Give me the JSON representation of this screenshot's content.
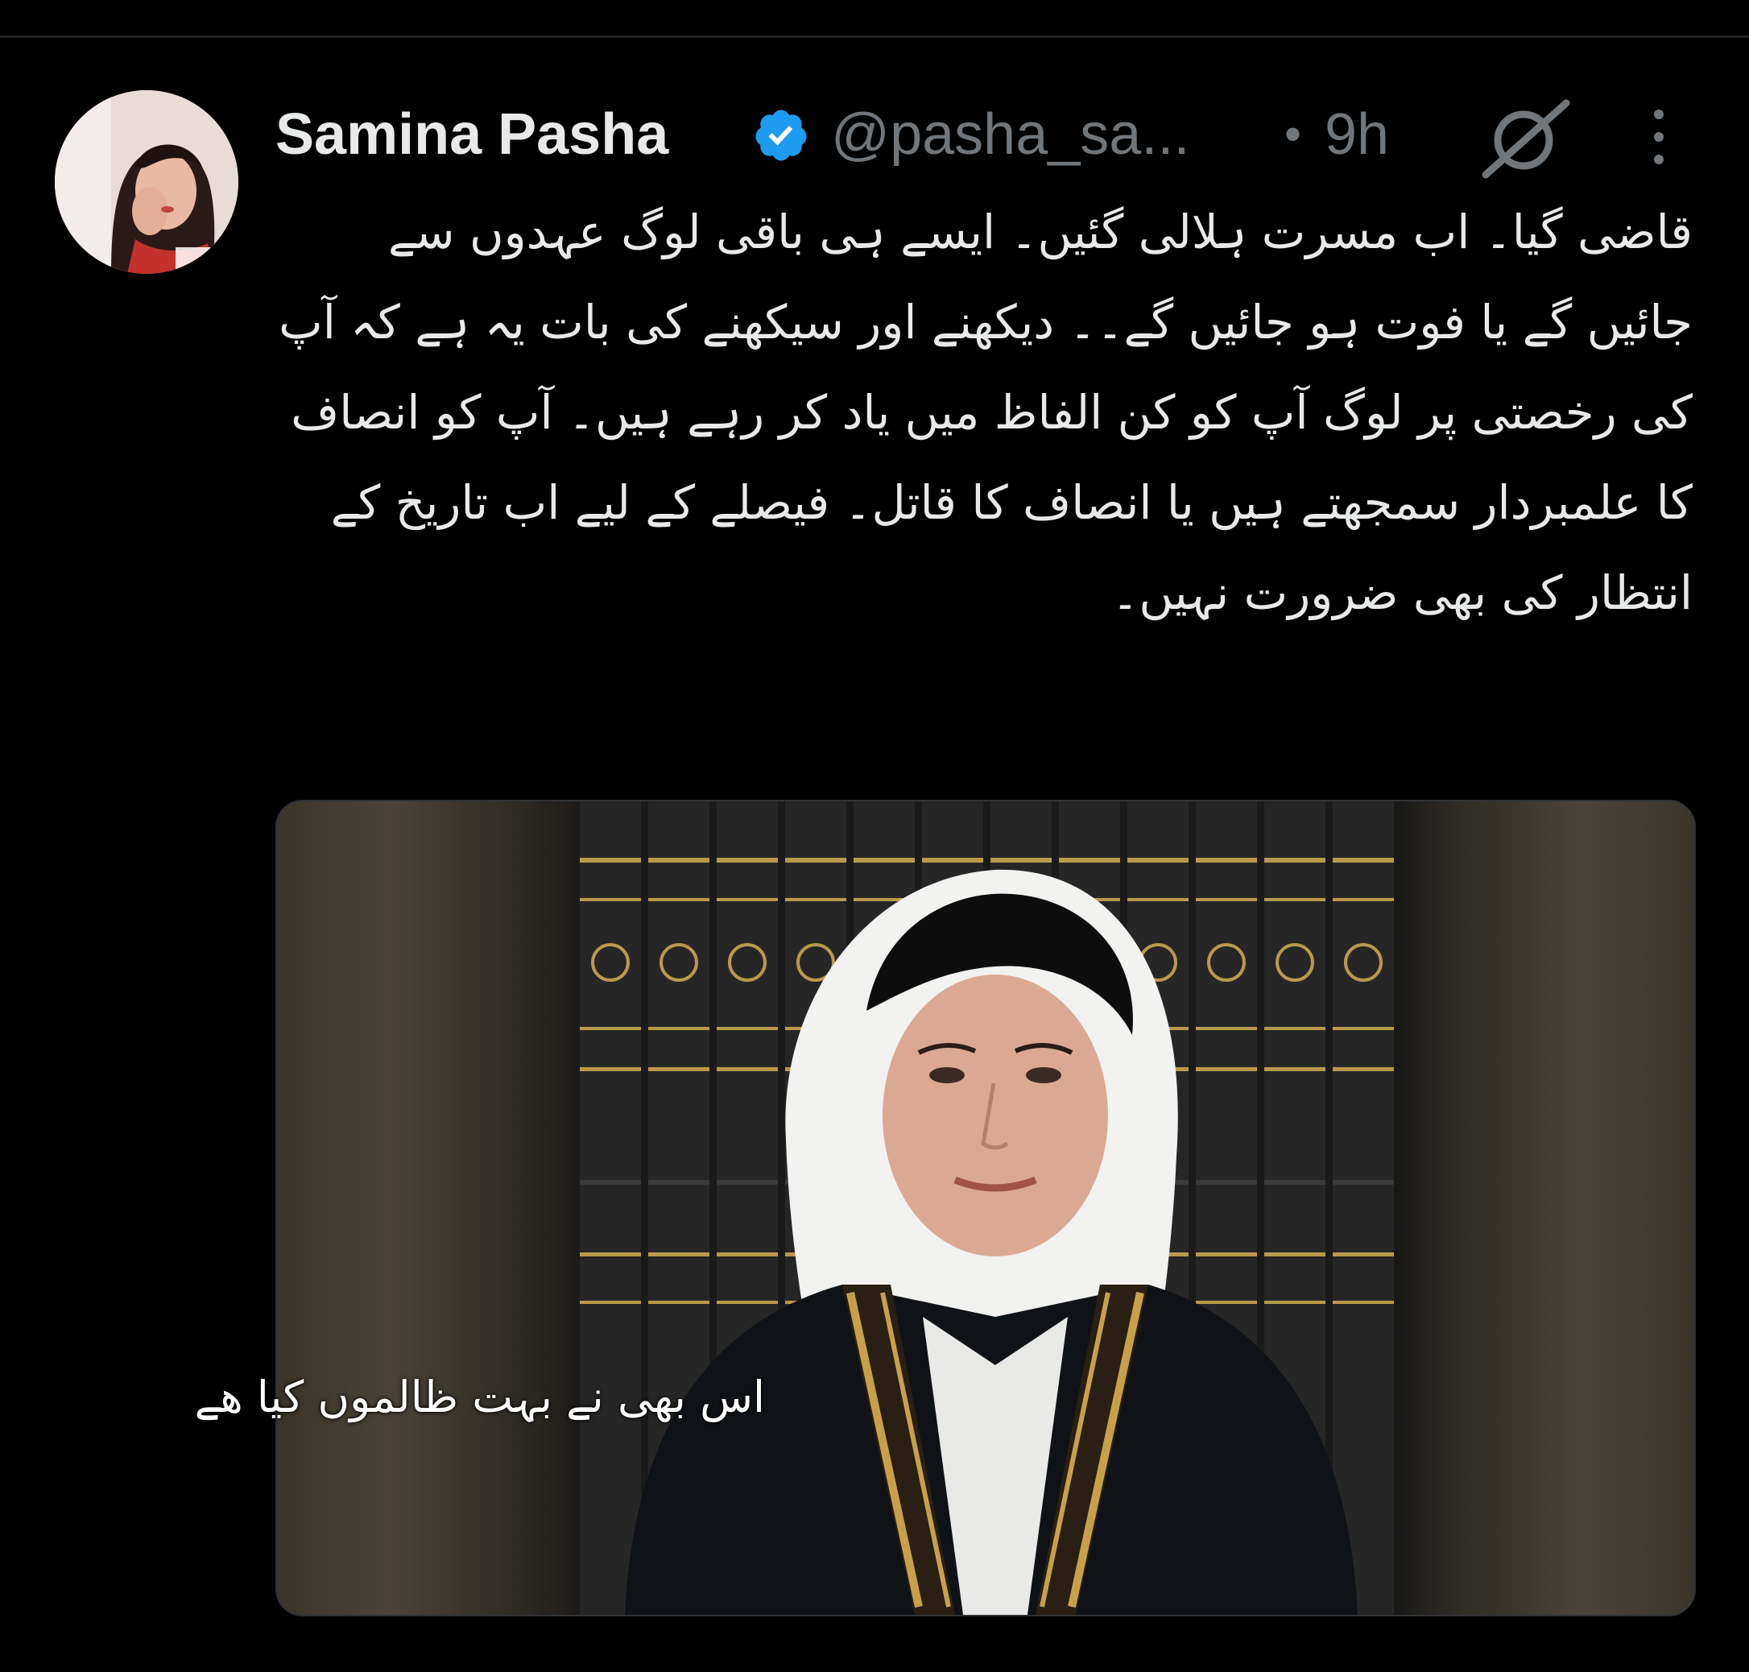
{
  "tweet": {
    "author": {
      "display_name": "Samina Pasha",
      "handle": "@pasha_sa...",
      "verified_icon": "verified-badge-icon",
      "verified_color": "#1d9bf0"
    },
    "separator": "•",
    "timestamp": "9h",
    "header_icons": [
      "grok-icon",
      "more-vertical-icon"
    ],
    "text": "قاضی گیا۔ اب مسرت ہلالی گئیں۔ ایسے ہی باقی لوگ عہدوں سے جائیں گے یا فوت ہو جائیں گے۔۔ دیکھنے اور سیکھنے کی بات یہ ہے کہ آپ کی رخصتی پر لوگ آپ کو کن الفاظ میں یاد کر رہے ہیں۔ آپ کو انصاف کا علمبردار سمجھتے ہیں یا انصاف کا قاتل۔ فیصلے کے لیے اب تاریخ کے انتظار کی بھی ضرورت نہیں۔",
    "media": {
      "caption_overlay": "اس بھی نے بہت ظالموں کیا ھے"
    }
  },
  "colors": {
    "background": "#000000",
    "primary_text": "#e7e9ea",
    "secondary_text": "#71767b",
    "accent": "#1d9bf0"
  }
}
